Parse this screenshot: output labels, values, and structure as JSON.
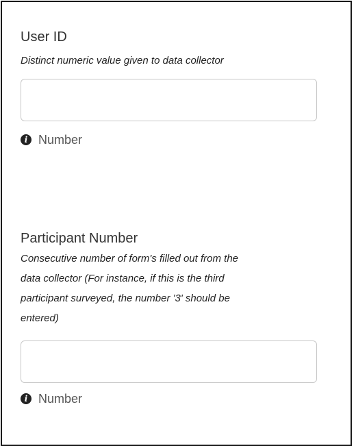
{
  "fields": [
    {
      "label": "User ID",
      "hint_lines": [
        "Distinct numeric value given to data collector"
      ],
      "value": "",
      "help_icon": "info-circle-icon",
      "help_text": "Number"
    },
    {
      "label": "Participant Number",
      "hint_lines": [
        "Consecutive number of form's filled out from the",
        "data collector (For instance, if this is the third",
        "participant surveyed, the number '3' should be",
        "entered)"
      ],
      "value": "",
      "help_icon": "info-circle-icon",
      "help_text": "Number"
    }
  ]
}
